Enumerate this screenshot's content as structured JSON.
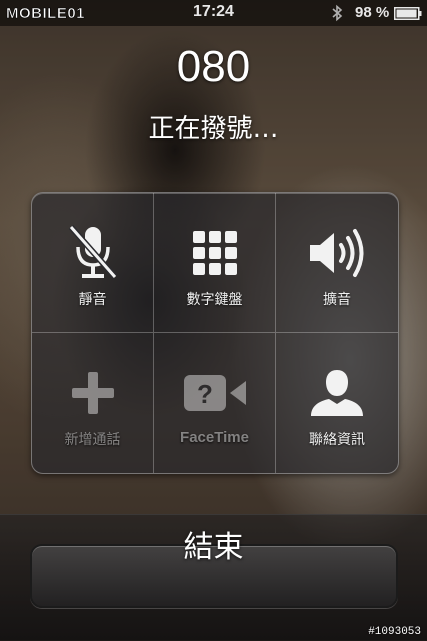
{
  "status_bar": {
    "watermark": "MOBILE01",
    "time": "17:24",
    "battery_percent": "98 %",
    "battery_level": 0.98
  },
  "call": {
    "number": "080",
    "status": "正在撥號…"
  },
  "controls": [
    {
      "label": "靜音",
      "icon": "mute-mic-icon",
      "enabled": true
    },
    {
      "label": "數字鍵盤",
      "icon": "keypad-icon",
      "enabled": true
    },
    {
      "label": "擴音",
      "icon": "speaker-icon",
      "enabled": true
    },
    {
      "label": "新增通話",
      "icon": "add-call-icon",
      "enabled": false
    },
    {
      "label": "FaceTime",
      "icon": "facetime-icon",
      "enabled": false
    },
    {
      "label": "聯絡資訊",
      "icon": "contacts-icon",
      "enabled": true
    }
  ],
  "end_call": {
    "label": "結束"
  },
  "photo_id": "#1093053",
  "colors": {
    "panel": "#28282c",
    "text": "#ffffff"
  }
}
